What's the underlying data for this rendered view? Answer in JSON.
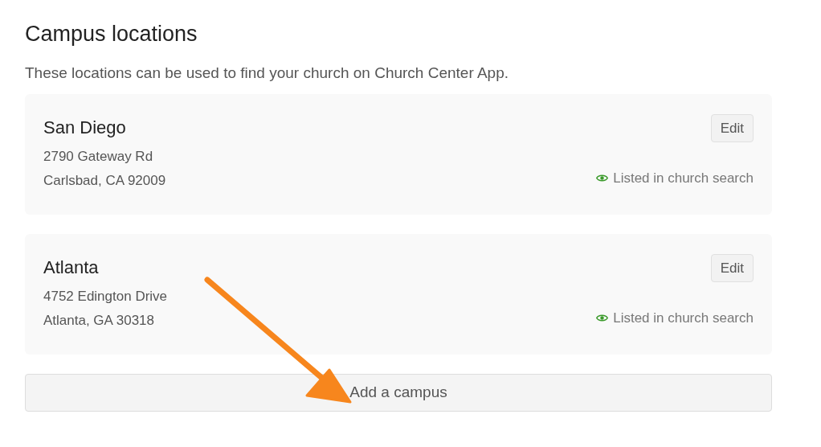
{
  "heading": "Campus locations",
  "description": "These locations can be used to find your church on Church Center App.",
  "campuses": [
    {
      "name": "San Diego",
      "address_line_1": "2790 Gateway Rd",
      "address_line_2": "Carlsbad, CA 92009",
      "edit_label": "Edit",
      "listed": true,
      "listed_label": "Listed in church search"
    },
    {
      "name": "Atlanta",
      "address_line_1": "4752 Edington Drive",
      "address_line_2": "Atlanta, GA 30318",
      "edit_label": "Edit",
      "listed": true,
      "listed_label": "Listed in church search"
    }
  ],
  "add_button": "Add a campus"
}
